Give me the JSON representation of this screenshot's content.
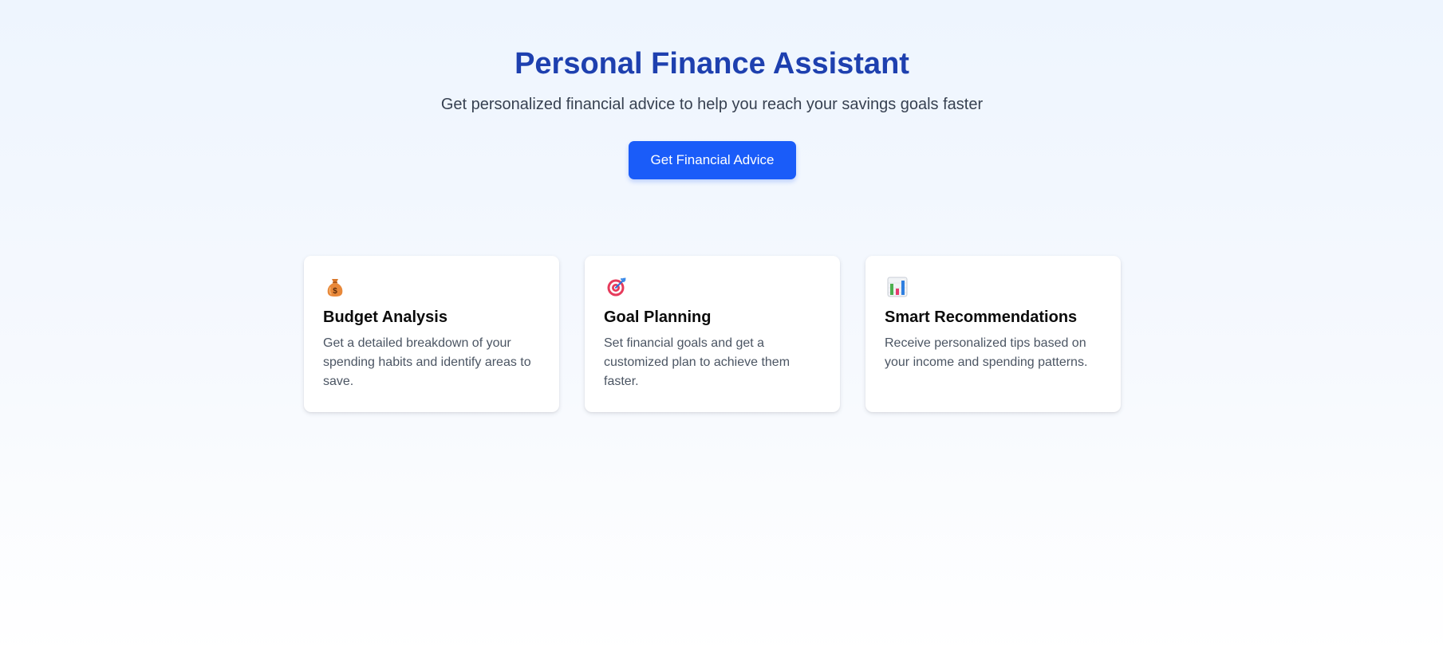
{
  "hero": {
    "title": "Personal Finance Assistant",
    "subtitle": "Get personalized financial advice to help you reach your savings goals faster",
    "cta_label": "Get Financial Advice"
  },
  "features": [
    {
      "icon": "money-bag-icon",
      "title": "Budget Analysis",
      "description": "Get a detailed breakdown of your spending habits and identify areas to save."
    },
    {
      "icon": "target-icon",
      "title": "Goal Planning",
      "description": "Set financial goals and get a customized plan to achieve them faster."
    },
    {
      "icon": "bar-chart-icon",
      "title": "Smart Recommendations",
      "description": "Receive personalized tips based on your income and spending patterns."
    }
  ],
  "colors": {
    "title": "#1e40af",
    "accent": "#1a5cf9",
    "card_background": "#ffffff",
    "page_background_top": "#eef5fe"
  }
}
